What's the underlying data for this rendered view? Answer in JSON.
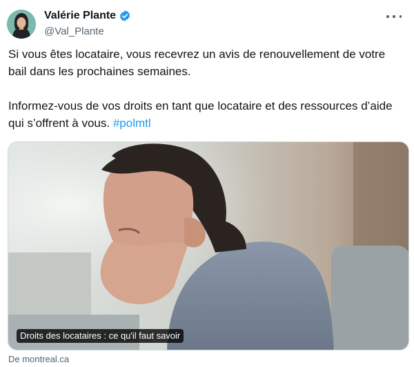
{
  "author": {
    "name": "Valérie Plante",
    "handle": "@Val_Plante",
    "verified": true,
    "avatar_icon": "user-avatar"
  },
  "tweet": {
    "paragraph1": "Si vous êtes locataire, vous recevrez un avis de renouvellement de votre bail dans les prochaines semaines.",
    "paragraph2_text": "Informez-vous de vos droits en tant que locataire et des ressources d’aide qui s’offrent à vous. ",
    "hashtag": "#polmtl"
  },
  "card": {
    "title": "Droits des locataires : ce qu'il faut savoir",
    "source": "De montreal.ca"
  },
  "colors": {
    "accent": "#1d9bf0",
    "text": "#0f1419",
    "secondary": "#536471"
  },
  "icons": {
    "verified": "verified-badge-icon",
    "more": "more-options-icon"
  }
}
